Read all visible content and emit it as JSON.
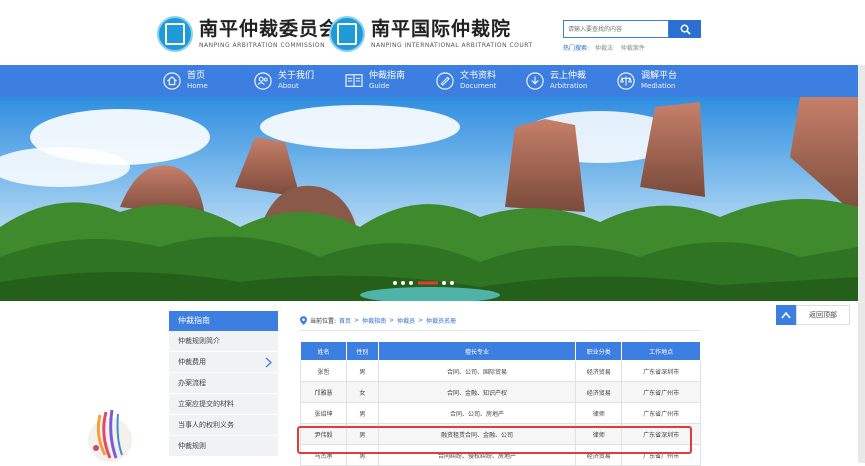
{
  "header": {
    "logo1": {
      "cn": "南平仲裁委员会",
      "en": "NANPING ARBITRATION COMMISSION"
    },
    "logo2": {
      "cn": "南平国际仲裁院",
      "en": "NANPING INTERNATIONAL ARBITRATION COURT"
    },
    "search": {
      "placeholder": "请输入要查找的内容"
    },
    "hot": {
      "label": "热门搜索:",
      "items": [
        "仲裁法",
        "仲裁案件"
      ]
    }
  },
  "nav": [
    {
      "cn": "首页",
      "en": "Home",
      "icon": "home-icon"
    },
    {
      "cn": "关于我们",
      "en": "About",
      "icon": "people-icon"
    },
    {
      "cn": "仲裁指南",
      "en": "Guide",
      "icon": "book-icon"
    },
    {
      "cn": "文书资料",
      "en": "Document",
      "icon": "document-icon"
    },
    {
      "cn": "云上仲裁",
      "en": "Arbitration",
      "icon": "cloud-icon"
    },
    {
      "cn": "调解平台",
      "en": "Mediation",
      "icon": "scale-icon"
    }
  ],
  "side": {
    "title": "仲裁指南",
    "items": [
      "仲裁规则简介",
      "仲裁费用",
      "办案流程",
      "立案应提交的材料",
      "当事人的权利义务",
      "仲裁规则"
    ]
  },
  "breadcrumb": {
    "label": "当前位置:",
    "items": [
      "首页",
      "仲裁指南",
      "仲裁员",
      "仲裁员名册"
    ]
  },
  "table": {
    "headers": [
      "姓名",
      "性别",
      "擅长专业",
      "职业分类",
      "工作地点"
    ],
    "rows": [
      [
        "张哲",
        "男",
        "合同、公司、国际贸易",
        "经济贸易",
        "广东省深圳市"
      ],
      [
        "邝雅慧",
        "女",
        "合同、金融、知识产权",
        "经济贸易",
        "广东省广州市"
      ],
      [
        "张绍坤",
        "男",
        "合同、公司、房地产",
        "律师",
        "广东省广州市"
      ],
      [
        "尹伟毅",
        "男",
        "融资租赁合同、金融、公司",
        "律师",
        "广东省深圳市"
      ],
      [
        "马杰承",
        "男",
        "合同纠纷、侵权纠纷、房地产",
        "经济贸易",
        "广东省广州市"
      ]
    ]
  },
  "backtop": {
    "label": "返回顶部"
  },
  "colors": {
    "primary": "#3d7fe1",
    "highlight": "#e23b3b"
  }
}
